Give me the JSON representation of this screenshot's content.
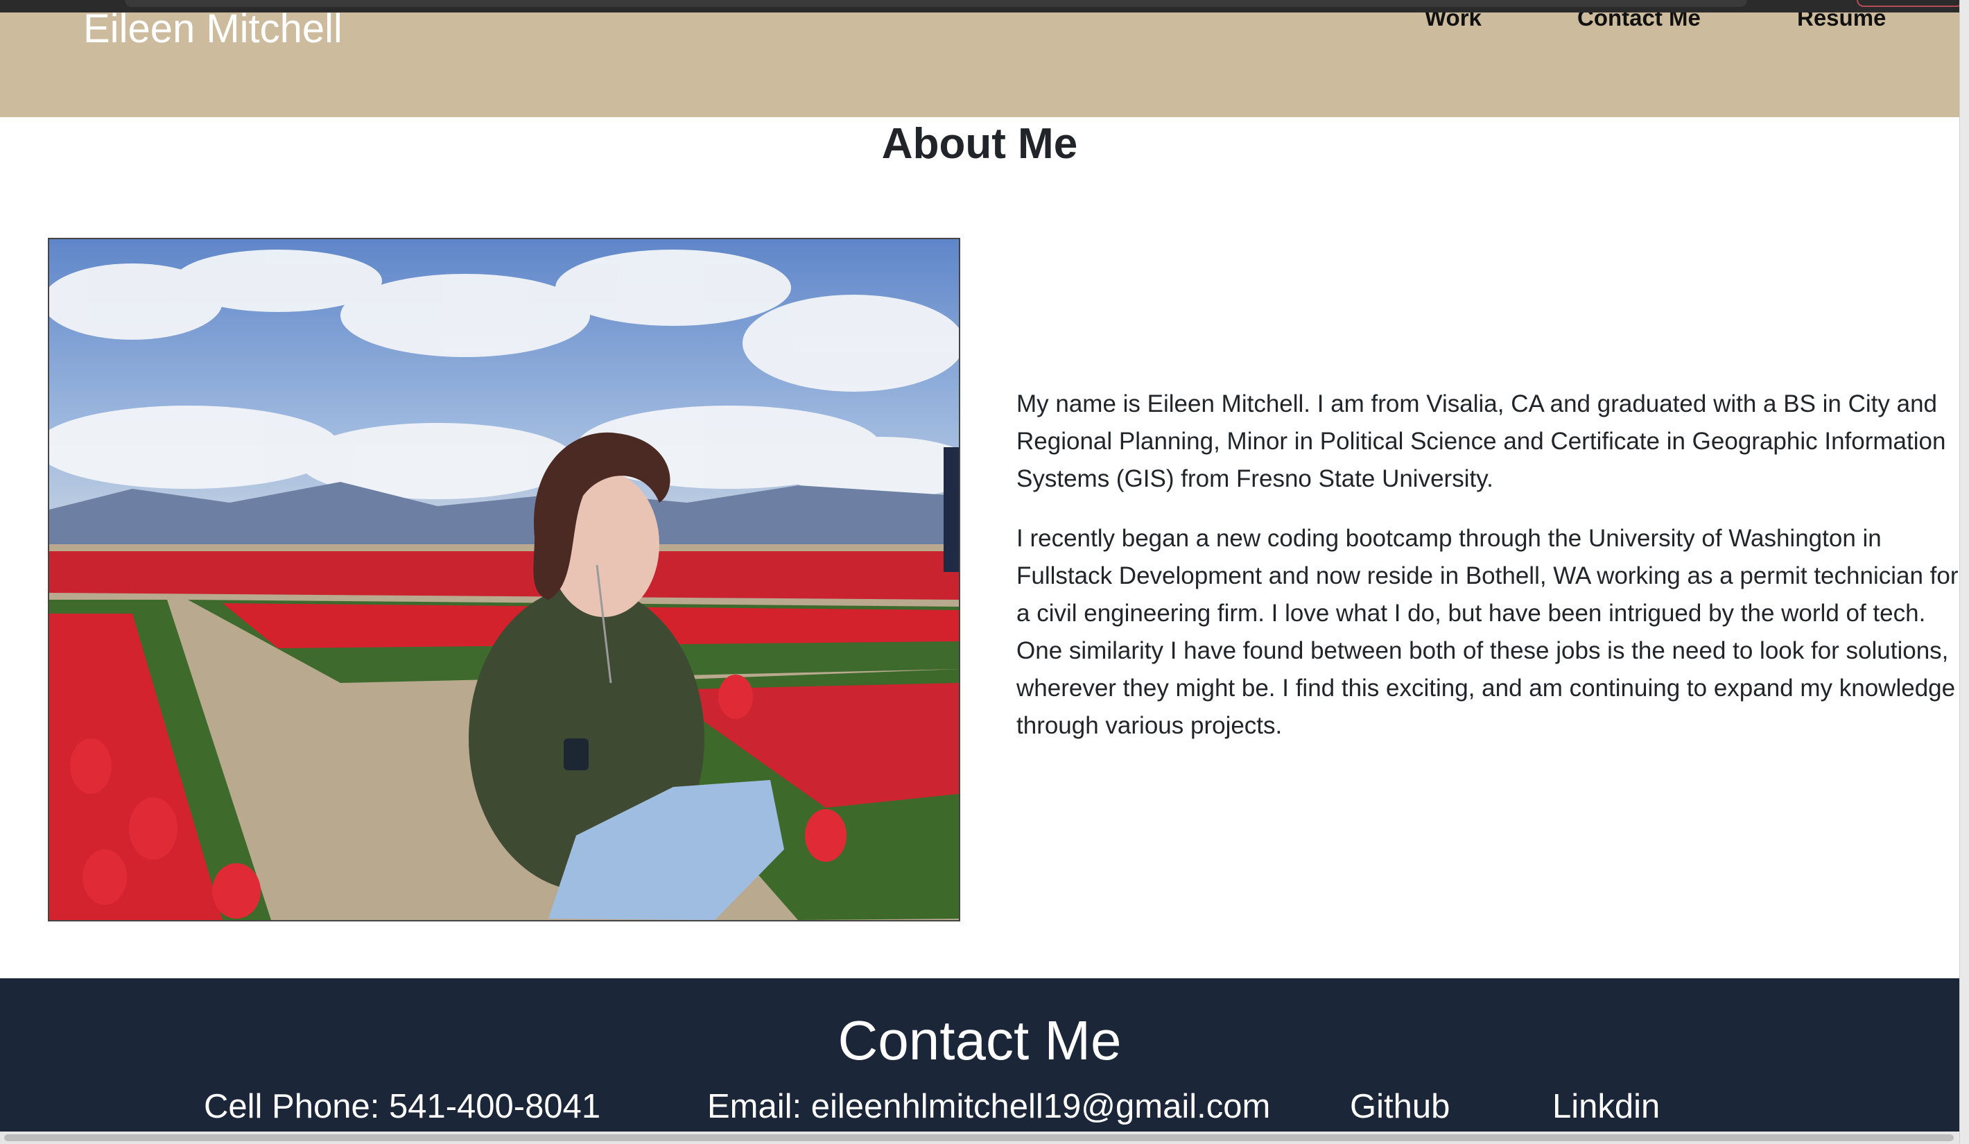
{
  "header": {
    "site_title": "Eileen Mitchell",
    "nav": [
      {
        "label": "Work"
      },
      {
        "label": "Contact Me"
      },
      {
        "label": "Resume"
      }
    ]
  },
  "about": {
    "title": "About Me",
    "paragraphs": [
      "My name is Eileen Mitchell. I am from Visalia, CA and graduated with a BS in City and Regional Planning, Minor in Political Science and Certificate in Geographic Information Systems (GIS) from Fresno State University.",
      "I recently began a new coding bootcamp through the University of Washington in Fullstack Development and now reside in Bothell, WA working as a permit technician for a civil engineering firm. I love what I do, but have been intrigued by the world of tech. One similarity I have found between both of these jobs is the need to look for solutions, wherever they might be. I find this exciting, and am continuing to expand my knowledge through various projects."
    ]
  },
  "contact": {
    "title": "Contact Me",
    "phone": "Cell Phone: 541-400-8041",
    "email": "Email: eileenhlmitchell19@gmail.com",
    "github": "Github",
    "linkdin": "Linkdin"
  },
  "colors": {
    "header_bg": "#ccbb9d",
    "contact_bg": "#1b2639",
    "text": "#212529"
  }
}
